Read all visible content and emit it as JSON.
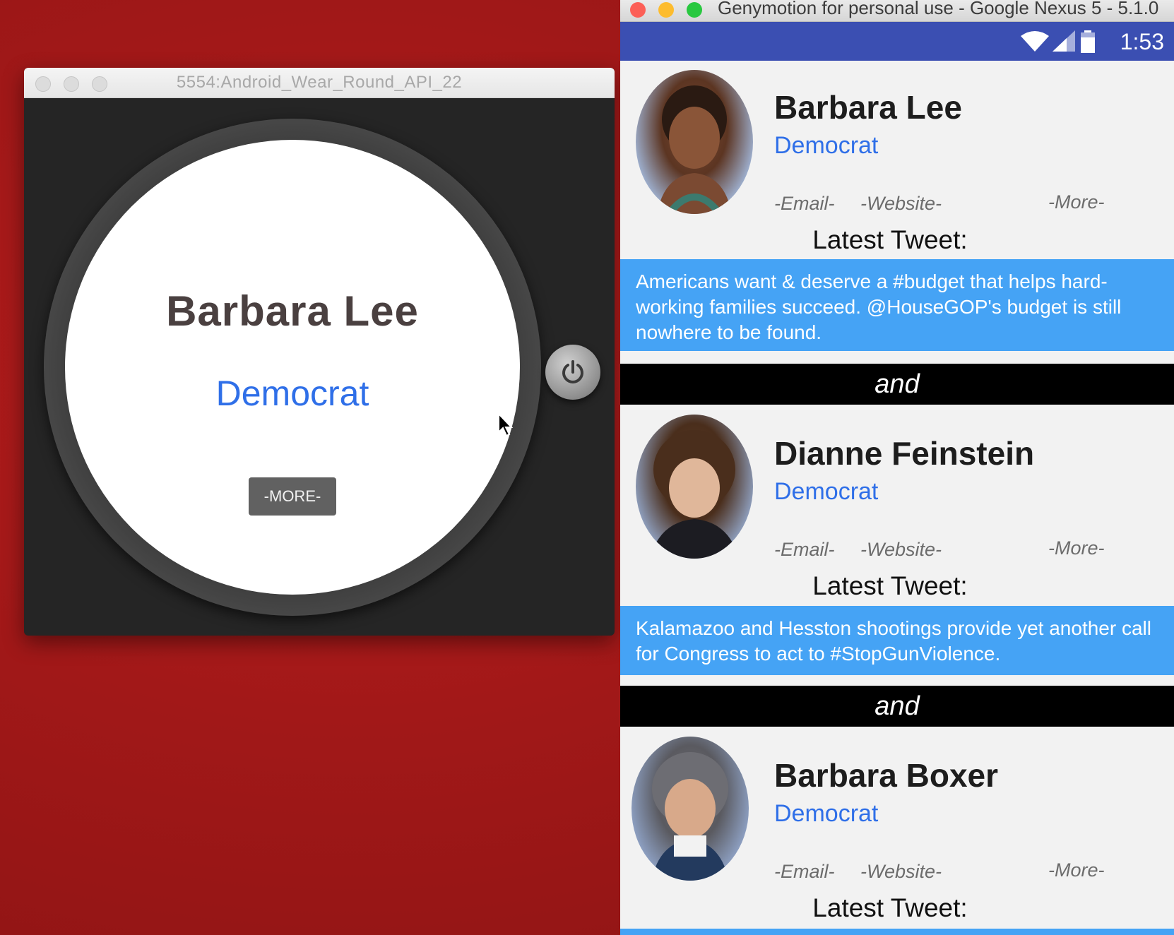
{
  "wear_window": {
    "title": "5554:Android_Wear_Round_API_22",
    "watch": {
      "name": "Barbara Lee",
      "party": "Democrat",
      "more_label": "-MORE-"
    }
  },
  "geny_window": {
    "title": "Genymotion for personal use - Google Nexus 5 - 5.1.0",
    "status_time": "1:53",
    "separator": "and",
    "cards": [
      {
        "name": "Barbara Lee",
        "party": "Democrat",
        "email": "-Email-",
        "website": "-Website-",
        "more": "-More-",
        "latest_label": "Latest Tweet:",
        "tweet": "Americans want & deserve a #budget that helps hard-working families succeed. @HouseGOP's budget is still nowhere to be found."
      },
      {
        "name": "Dianne Feinstein",
        "party": "Democrat",
        "email": "-Email-",
        "website": "-Website-",
        "more": "-More-",
        "latest_label": "Latest Tweet:",
        "tweet": "Kalamazoo and Hesston shootings provide yet another call for Congress to act to #StopGunViolence."
      },
      {
        "name": "Barbara Boxer",
        "party": "Democrat",
        "email": "-Email-",
        "website": "-Website-",
        "more": "-More-",
        "latest_label": "Latest Tweet:",
        "tweet": ""
      }
    ]
  },
  "colors": {
    "party_blue": "#2f6fe8",
    "tweet_bg": "#45a3f5",
    "status_bar": "#3b4fb2",
    "desktop_red": "#a11818"
  }
}
